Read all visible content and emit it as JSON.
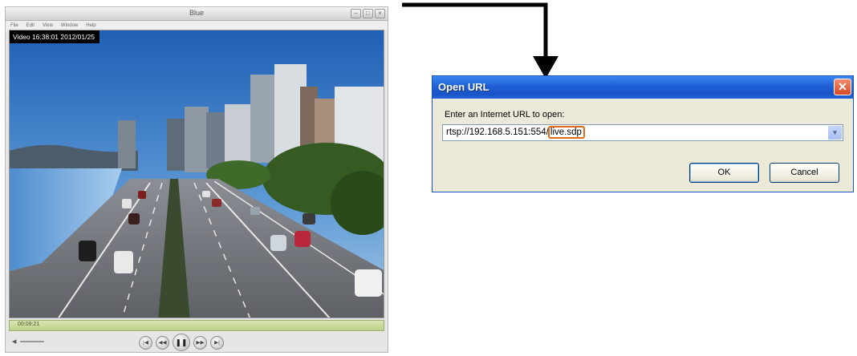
{
  "player": {
    "title": "Blue",
    "menu": [
      "File",
      "Edit",
      "View",
      "Window",
      "Help"
    ],
    "overlay_label": "Video 16:38:01 2012/01/25",
    "elapsed_time": "00:09:21",
    "controls": {
      "start_label": "|◀",
      "rewind_label": "◀◀",
      "pause_label": "❚❚",
      "forward_label": "▶▶",
      "end_label": "▶|"
    },
    "window_buttons": [
      "–",
      "□",
      "×"
    ]
  },
  "dialog": {
    "title": "Open URL",
    "prompt": "Enter an Internet URL to open:",
    "url_prefix": "rtsp://192.168.5.151:554/",
    "url_highlight": "live.sdp",
    "dropdown_glyph": "▼",
    "close_glyph": "✕",
    "ok_label": "OK",
    "cancel_label": "Cancel",
    "highlight_color": "#e06a1a",
    "titlebar_color": "#1f5fd6"
  }
}
